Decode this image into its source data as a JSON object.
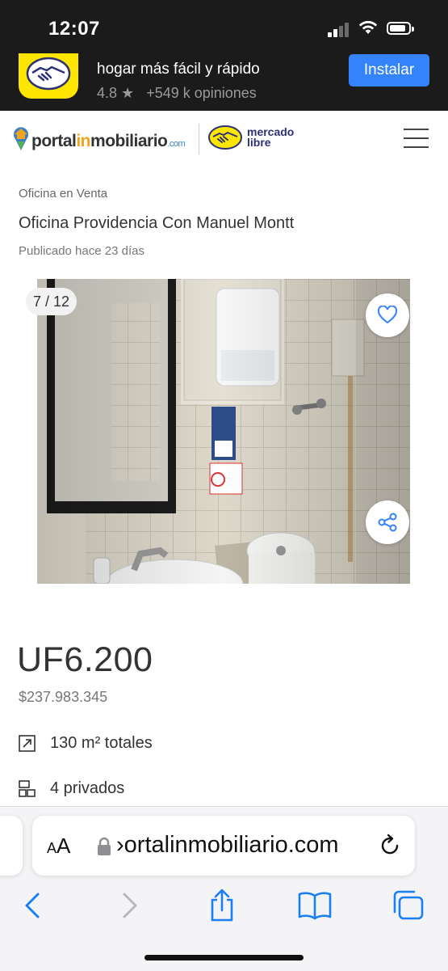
{
  "status_bar": {
    "time": "12:07"
  },
  "app_banner": {
    "title": "hogar más fácil y rápido",
    "rating": "4.8",
    "reviews": "+549 k opiniones",
    "install_label": "Instalar",
    "app_icon": "mercadolibre-handshake-icon"
  },
  "header": {
    "portal_logo": {
      "part1": "portal",
      "part2": "in",
      "part3": "mobiliario",
      "part4": ".com"
    },
    "mercadolibre_logo": {
      "line1": "mercado",
      "line2": "libre"
    },
    "menu_icon": "hamburger-icon"
  },
  "listing": {
    "property_type": "Oficina en Venta",
    "title": "Oficina Providencia Con Manuel Montt",
    "published": "Publicado hace 23 días",
    "photo_counter": "7 / 12",
    "current_photo": 7,
    "total_photos": 12,
    "price": "UF6.200",
    "price_clp": "$237.983.345",
    "features": [
      {
        "icon": "area-expand-icon",
        "label": "130 m² totales"
      },
      {
        "icon": "office-rooms-icon",
        "label": "4 privados"
      }
    ]
  },
  "browser": {
    "aa_label_large": "A",
    "aa_label_small": "A",
    "aa_label": "AA",
    "url": "portalinmobiliario.com",
    "url_display": "›ortalinmobiliario.com"
  },
  "colors": {
    "accent_blue": "#3483fa",
    "ml_yellow": "#ffe600",
    "portal_orange": "#f2a31b",
    "dark_banner": "#1b1b1b",
    "safari_blue": "#1a7ff0"
  }
}
